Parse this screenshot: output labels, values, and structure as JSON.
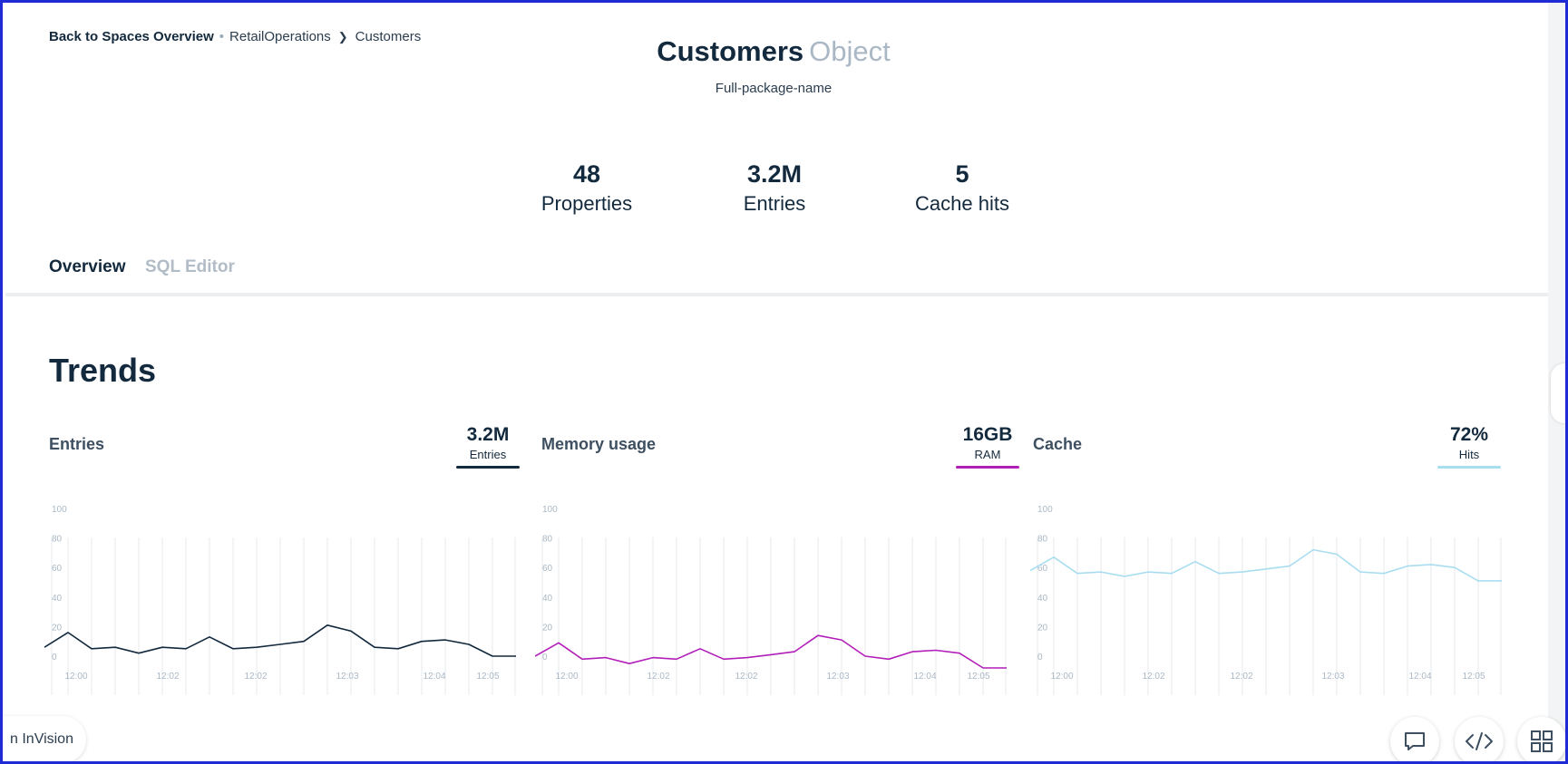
{
  "breadcrumb": {
    "back": "Back to Spaces Overview",
    "space": "RetailOperations",
    "object": "Customers"
  },
  "header": {
    "title": "Customers",
    "type": "Object",
    "subtitle": "Full-package-name"
  },
  "stats": [
    {
      "value": "48",
      "label": "Properties"
    },
    {
      "value": "3.2M",
      "label": "Entries"
    },
    {
      "value": "5",
      "label": "Cache hits"
    }
  ],
  "tabs": [
    {
      "label": "Overview",
      "active": true
    },
    {
      "label": "SQL Editor",
      "active": false
    }
  ],
  "section_title": "Trends",
  "panels": [
    {
      "label": "Entries",
      "metric": "3.2M",
      "unit": "Entries",
      "color": "#13293d"
    },
    {
      "label": "Memory usage",
      "metric": "16GB",
      "unit": "RAM",
      "color": "#b21fb8"
    },
    {
      "label": "Cache",
      "metric": "72%",
      "unit": "Hits",
      "color": "#a8ddf0"
    }
  ],
  "chart_data": [
    {
      "type": "line",
      "y_ticks": [
        "100",
        "80",
        "60",
        "40",
        "20",
        "0"
      ],
      "x_ticks": [
        "12:00",
        "12:02",
        "12:02",
        "12:03",
        "12:04",
        "12:05"
      ],
      "ylim": [
        0,
        100
      ],
      "values": [
        6,
        16,
        5,
        6,
        2,
        6,
        5,
        13,
        5,
        6,
        8,
        10,
        21,
        17,
        6,
        5,
        10,
        11,
        8,
        0,
        0
      ],
      "color": "#13293d",
      "grid": true
    },
    {
      "type": "line",
      "y_ticks": [
        "100",
        "80",
        "60",
        "40",
        "20",
        "0"
      ],
      "x_ticks": [
        "12:00",
        "12:02",
        "12:02",
        "12:03",
        "12:04",
        "12:05"
      ],
      "ylim": [
        0,
        100
      ],
      "values": [
        0,
        9,
        -2,
        -1,
        -5,
        -1,
        -2,
        5,
        -2,
        -1,
        1,
        3,
        14,
        11,
        0,
        -2,
        3,
        4,
        2,
        -8,
        -8
      ],
      "color": "#b21fb8",
      "grid": true
    },
    {
      "type": "line",
      "y_ticks": [
        "100",
        "80",
        "60",
        "40",
        "20",
        "0"
      ],
      "x_ticks": [
        "12:00",
        "12:02",
        "12:02",
        "12:03",
        "12:04",
        "12:05"
      ],
      "ylim": [
        0,
        100
      ],
      "values": [
        58,
        67,
        56,
        57,
        54,
        57,
        56,
        64,
        56,
        57,
        59,
        61,
        72,
        69,
        57,
        56,
        61,
        62,
        60,
        51,
        51
      ],
      "color": "#a8ddf0",
      "grid": true
    }
  ],
  "footer": {
    "invision": "n InVision"
  },
  "icons": {
    "comment": "comment-icon",
    "code": "code-icon",
    "grid": "grid-icon"
  }
}
